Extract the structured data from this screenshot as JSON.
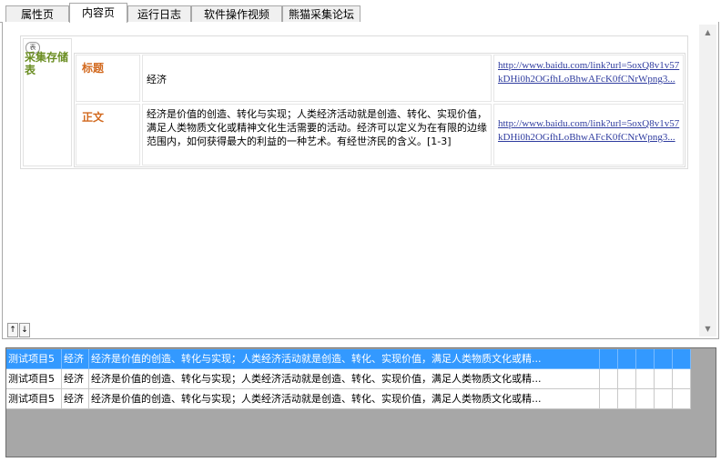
{
  "tabs": [
    {
      "label": "属性页",
      "active": false
    },
    {
      "label": "内容页",
      "active": true
    },
    {
      "label": "运行日志",
      "active": false
    },
    {
      "label": "软件操作视频",
      "active": false
    },
    {
      "label": "熊猫采集论坛",
      "active": false
    }
  ],
  "content": {
    "table_tag": "表",
    "store_title": "采集存储表",
    "fields": [
      {
        "label": "标题",
        "value": "经济",
        "url": "http://www.baidu.com/link?url=5oxQ8v1v57kDHi0h2OGfhLoBhwAFcK0fCNrWpng3..."
      },
      {
        "label": "正文",
        "value": "经济是价值的创造、转化与实现；人类经济活动就是创造、转化、实现价值，满足人类物质文化或精神文化生活需要的活动。经济可以定义为在有限的边缘范围内，如何获得最大的利益的一种艺术。有经世济民的含义。[1-3]",
        "url": "http://www.baidu.com/link?url=5oxQ8v1v57kDHi0h2OGfhLoBhwAFcK0fCNrWpng3..."
      }
    ],
    "sort_buttons": [
      "↑",
      "↓"
    ]
  },
  "grid": {
    "rows": [
      {
        "project": "测试项目5",
        "title": "经济",
        "content": "经济是价值的创造、转化与实现；人类经济活动就是创造、转化、实现价值，满足人类物质文化或精...",
        "selected": true
      },
      {
        "project": "测试项目5",
        "title": "经济",
        "content": "经济是价值的创造、转化与实现；人类经济活动就是创造、转化、实现价值，满足人类物质文化或精...",
        "selected": false
      },
      {
        "project": "测试项目5",
        "title": "经济",
        "content": "经济是价值的创造、转化与实现；人类经济活动就是创造、转化、实现价值，满足人类物质文化或精...",
        "selected": false
      }
    ]
  },
  "colors": {
    "selected_row": "#3399ff",
    "field_label": "#d2691e",
    "store_title": "#6b8e23",
    "link": "#2f3c9f"
  }
}
